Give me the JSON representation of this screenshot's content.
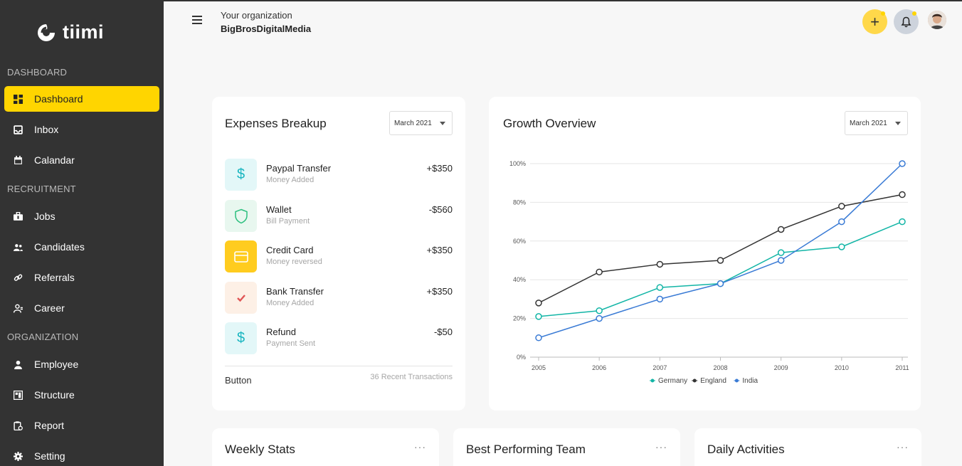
{
  "app": {
    "name": "tiimi"
  },
  "sidebar": {
    "sections": [
      {
        "label": "DASHBOARD"
      },
      {
        "label": "RECRUITMENT"
      },
      {
        "label": "ORGANIZATION"
      }
    ],
    "items": [
      {
        "label": "Dashboard",
        "icon": "dashboard-icon"
      },
      {
        "label": "Inbox",
        "icon": "inbox-icon"
      },
      {
        "label": "Calandar",
        "icon": "calendar-icon"
      },
      {
        "label": "Jobs",
        "icon": "briefcase-icon"
      },
      {
        "label": "Candidates",
        "icon": "users-icon"
      },
      {
        "label": "Referrals",
        "icon": "link-icon"
      },
      {
        "label": "Career",
        "icon": "person-icon"
      },
      {
        "label": "Employee",
        "icon": "person-icon"
      },
      {
        "label": "Structure",
        "icon": "structure-icon"
      },
      {
        "label": "Report",
        "icon": "report-icon"
      },
      {
        "label": "Setting",
        "icon": "gear-icon"
      }
    ]
  },
  "header": {
    "org_label": "Your organization",
    "org_name": "BigBrosDigitalMedia"
  },
  "expenses": {
    "title": "Expenses Breakup",
    "period": "March 2021",
    "transactions": [
      {
        "title": "Paypal Transfer",
        "sub": "Money Added",
        "amount": "+$350",
        "icon": "dollar-icon"
      },
      {
        "title": "Wallet",
        "sub": "Bill Payment",
        "amount": "-$560",
        "icon": "shield-icon"
      },
      {
        "title": "Credit Card",
        "sub": "Money reversed",
        "amount": "+$350",
        "icon": "credit-card-icon"
      },
      {
        "title": "Bank Transfer",
        "sub": "Money Added",
        "amount": "+$350",
        "icon": "check-icon"
      },
      {
        "title": "Refund",
        "sub": "Payment Sent",
        "amount": "-$50",
        "icon": "dollar-icon"
      }
    ],
    "button_label": "Button",
    "recent": "36 Recent Transactions"
  },
  "growth": {
    "title": "Growth Overview",
    "period": "March 2021"
  },
  "chart_data": {
    "type": "line",
    "x": [
      "2005",
      "2006",
      "2007",
      "2008",
      "2009",
      "2010",
      "2011"
    ],
    "ylim": [
      0,
      100
    ],
    "yticks": [
      "0%",
      "20%",
      "40%",
      "60%",
      "80%",
      "100%"
    ],
    "series": [
      {
        "name": "Germany",
        "color": "#12b5a6",
        "values": [
          21,
          24,
          36,
          38,
          54,
          57,
          70
        ]
      },
      {
        "name": "England",
        "color": "#333333",
        "values": [
          28,
          44,
          48,
          50,
          66,
          78,
          84
        ]
      },
      {
        "name": "India",
        "color": "#3a7bd5",
        "values": [
          10,
          20,
          30,
          38,
          50,
          70,
          100
        ]
      }
    ],
    "legend": "bottom-center",
    "grid": true
  },
  "bottom_cards": [
    {
      "title": "Weekly Stats"
    },
    {
      "title": "Best Performing Team"
    },
    {
      "title": "Daily Activities"
    }
  ],
  "colors": {
    "accent": "#ffd500",
    "sidebar": "#333333"
  }
}
